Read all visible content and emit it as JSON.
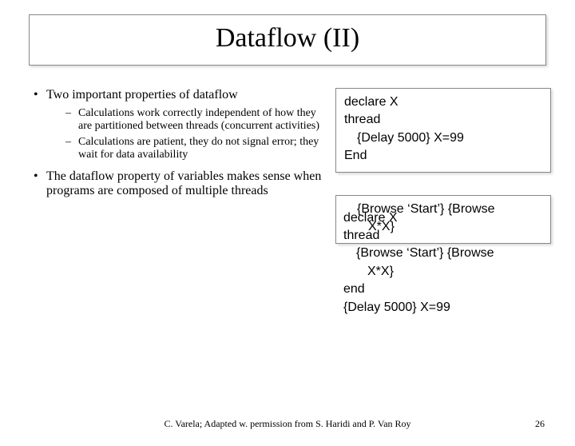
{
  "title": "Dataflow (II)",
  "bullets": {
    "b1": "Two important properties of dataflow",
    "b1a": "Calculations work correctly independent of how they are partitioned between threads (concurrent activities)",
    "b1b": "Calculations are patient, they do not signal error; they wait for data availability",
    "b2": "The dataflow property of variables makes sense when programs are composed of multiple threads"
  },
  "code1": {
    "l1": "declare X",
    "l2": "thread",
    "l3": "{Delay 5000} X=99",
    "l4": "End"
  },
  "overlay": {
    "l1": "{Browse ‘Start’} {Browse",
    "l2": "X*X}"
  },
  "code2": {
    "l1": "declare X",
    "l2": "thread",
    "l3": "{Browse ‘Start’} {Browse",
    "l4": "X*X}",
    "l5": "end",
    "l6": "{Delay 5000} X=99"
  },
  "footer": "C. Varela;  Adapted w. permission from S. Haridi and P. Van Roy",
  "page": "26"
}
